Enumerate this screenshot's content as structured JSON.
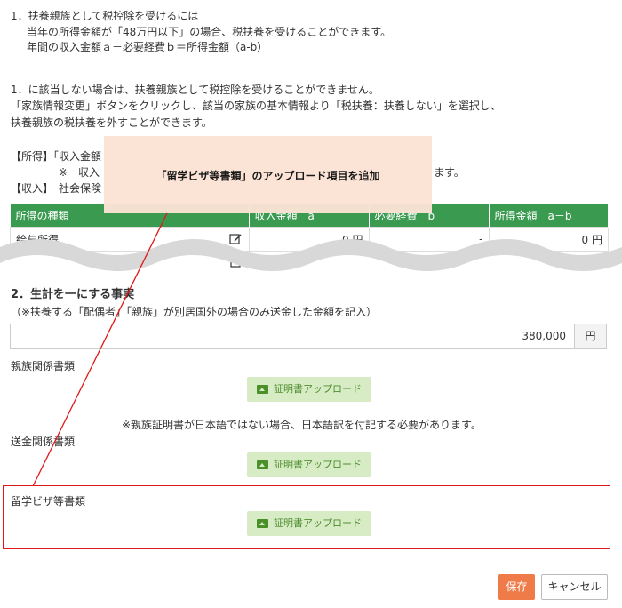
{
  "intro": {
    "line1": "1．扶養親族として税控除を受けるには",
    "line2": "当年の所得金額が「48万円以下」の場合、税扶養を受けることができます。",
    "line3": "年間の収入金額ａ－必要経費ｂ＝所得金額（a-b）",
    "line4": "1．に該当しない場合は、扶養親族として税控除を受けることができません。",
    "line5": "「家族情報変更」ボタンをクリックし、該当の家族の基本情報より「税扶養：扶養しない」を選択し、",
    "line6": "扶養親族の税扶養を外すことができます。",
    "note1": "【所得】「収入金額",
    "note2": "※　収入",
    "note2_end": "ます。",
    "note3": "【収入】　社会保険"
  },
  "callout": {
    "text": "「留学ビザ等書類」のアップロード項目を追加"
  },
  "table": {
    "headers": [
      "所得の種類",
      "収入金額　a",
      "必要経費　b",
      "所得金額　a－b"
    ],
    "rows": [
      {
        "type": "給与所得",
        "income": "0 円",
        "expense": "-",
        "net": "0 円"
      }
    ]
  },
  "section2": {
    "title": "2．生計を一にする事実",
    "subtitle": "（※扶養する「配偶者」「親族」が別居国外の場合のみ送金した金額を記入）",
    "amount": "380,000",
    "unit": "円"
  },
  "docs": {
    "relation_label": "親族関係書類",
    "upload_label": "証明書アップロード",
    "relation_note": "※親族証明書が日本語ではない場合、日本語訳を付記する必要があります。",
    "remittance_label": "送金関係書類",
    "visa_label": "留学ビザ等書類"
  },
  "footer": {
    "save": "保存",
    "cancel": "キャンセル"
  },
  "colors": {
    "header_green": "#3a9b50",
    "upload_bg": "#d7ecc4",
    "save_orange": "#ee7b48",
    "highlight_red": "#e01818",
    "callout_bg": "#fbe3d4"
  }
}
